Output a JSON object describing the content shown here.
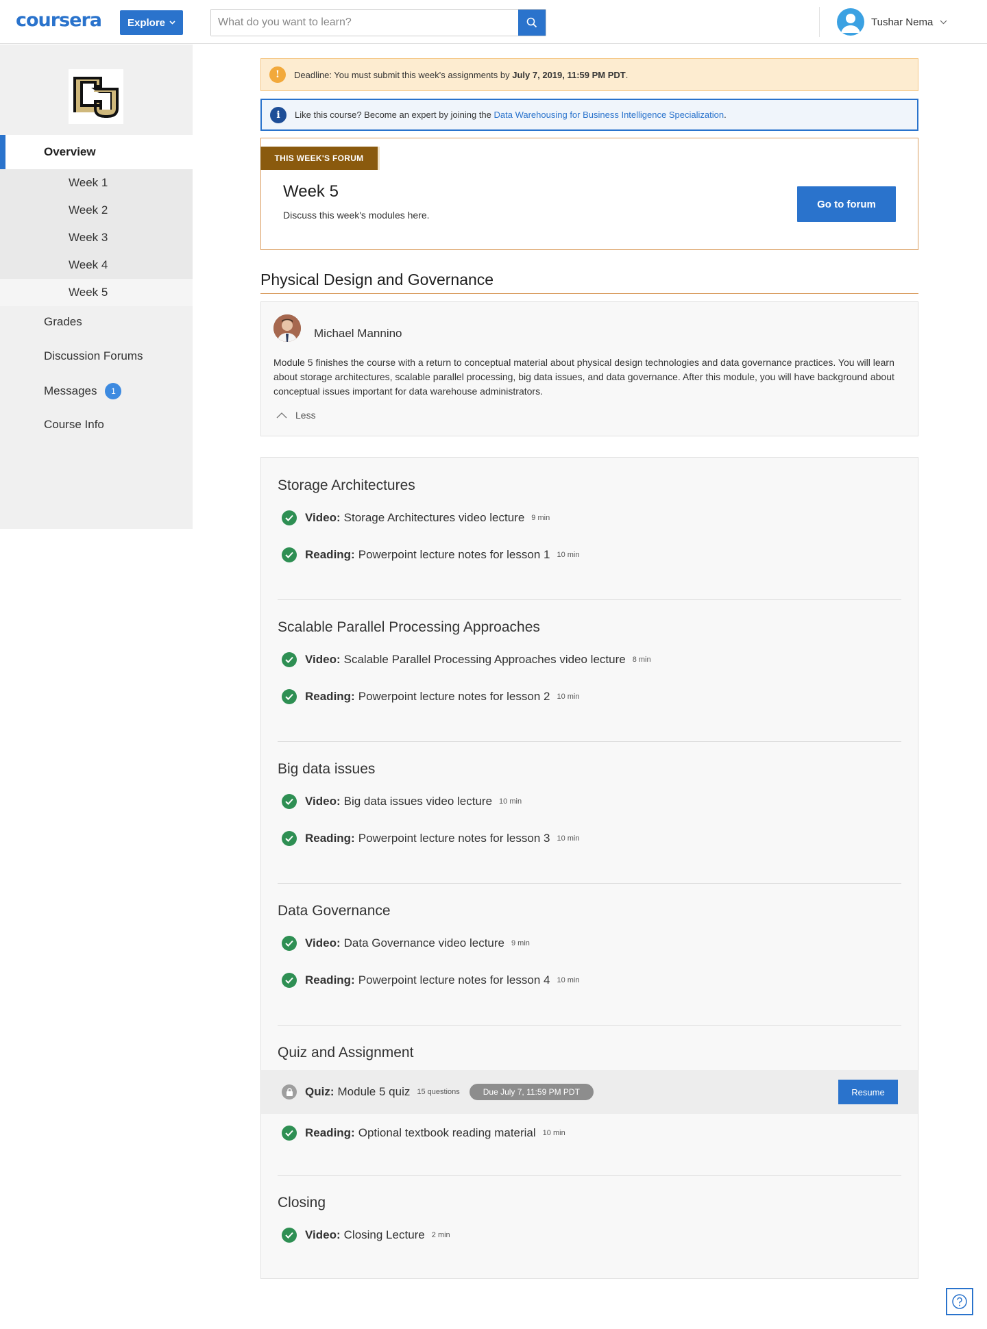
{
  "header": {
    "logo": "coursera",
    "explore_label": "Explore",
    "search_placeholder": "What do you want to learn?",
    "user_name": "Tushar Nema"
  },
  "sidebar": {
    "overview": "Overview",
    "weeks": [
      "Week 1",
      "Week 2",
      "Week 3",
      "Week 4",
      "Week 5"
    ],
    "active_week": "Week 5",
    "grades": "Grades",
    "forums": "Discussion Forums",
    "messages": "Messages",
    "messages_count": "1",
    "course_info": "Course Info"
  },
  "alerts": {
    "deadline_prefix": "Deadline: You must submit this week's assignments by ",
    "deadline_date": "July 7, 2019, 11:59 PM PDT",
    "deadline_suffix": ".",
    "info_prefix": "Like this course? Become an expert by joining the ",
    "info_link": "Data Warehousing for Business Intelligence Specialization",
    "info_suffix": "."
  },
  "forum": {
    "tag": "THIS WEEK'S FORUM",
    "title": "Week 5",
    "subtitle": "Discuss this week's modules here.",
    "button": "Go to forum"
  },
  "module": {
    "title": "Physical Design and Governance",
    "instructor": "Michael Mannino",
    "description": "Module 5 finishes the course with a return to conceptual material about physical design technologies and data governance practices. You will learn about storage architectures, scalable parallel processing, big data issues, and data governance. After this module, you will have background about conceptual issues important for data warehouse administrators.",
    "less_label": "Less"
  },
  "lessons": [
    {
      "title": "Storage Architectures",
      "items": [
        {
          "kind": "Video:",
          "name": "Storage Architectures video lecture",
          "dur": "9 min"
        },
        {
          "kind": "Reading:",
          "name": "Powerpoint lecture notes for lesson 1",
          "dur": "10 min"
        }
      ]
    },
    {
      "title": "Scalable Parallel Processing Approaches",
      "items": [
        {
          "kind": "Video:",
          "name": "Scalable Parallel Processing Approaches video lecture",
          "dur": "8 min"
        },
        {
          "kind": "Reading:",
          "name": "Powerpoint lecture notes for lesson 2",
          "dur": "10 min"
        }
      ]
    },
    {
      "title": "Big data issues",
      "items": [
        {
          "kind": "Video:",
          "name": "Big data issues video lecture",
          "dur": "10 min"
        },
        {
          "kind": "Reading:",
          "name": "Powerpoint lecture notes for lesson 3",
          "dur": "10 min"
        }
      ]
    },
    {
      "title": "Data Governance",
      "items": [
        {
          "kind": "Video:",
          "name": "Data Governance video lecture",
          "dur": "9 min"
        },
        {
          "kind": "Reading:",
          "name": "Powerpoint lecture notes for lesson 4",
          "dur": "10 min"
        }
      ]
    },
    {
      "title": "Quiz and Assignment",
      "quiz": {
        "kind": "Quiz:",
        "name": "Module 5 quiz",
        "questions": "15 questions",
        "due": "Due July 7, 11:59 PM PDT",
        "button": "Resume"
      },
      "items": [
        {
          "kind": "Reading:",
          "name": "Optional textbook reading material",
          "dur": "10 min"
        }
      ]
    },
    {
      "title": "Closing",
      "items": [
        {
          "kind": "Video:",
          "name": "Closing Lecture",
          "dur": "2 min"
        }
      ]
    }
  ],
  "colors": {
    "brand": "#2a73cc",
    "complete": "#2e8f53",
    "forum_tag": "#8a5a0e",
    "deadline_bg": "#fdecd0"
  }
}
